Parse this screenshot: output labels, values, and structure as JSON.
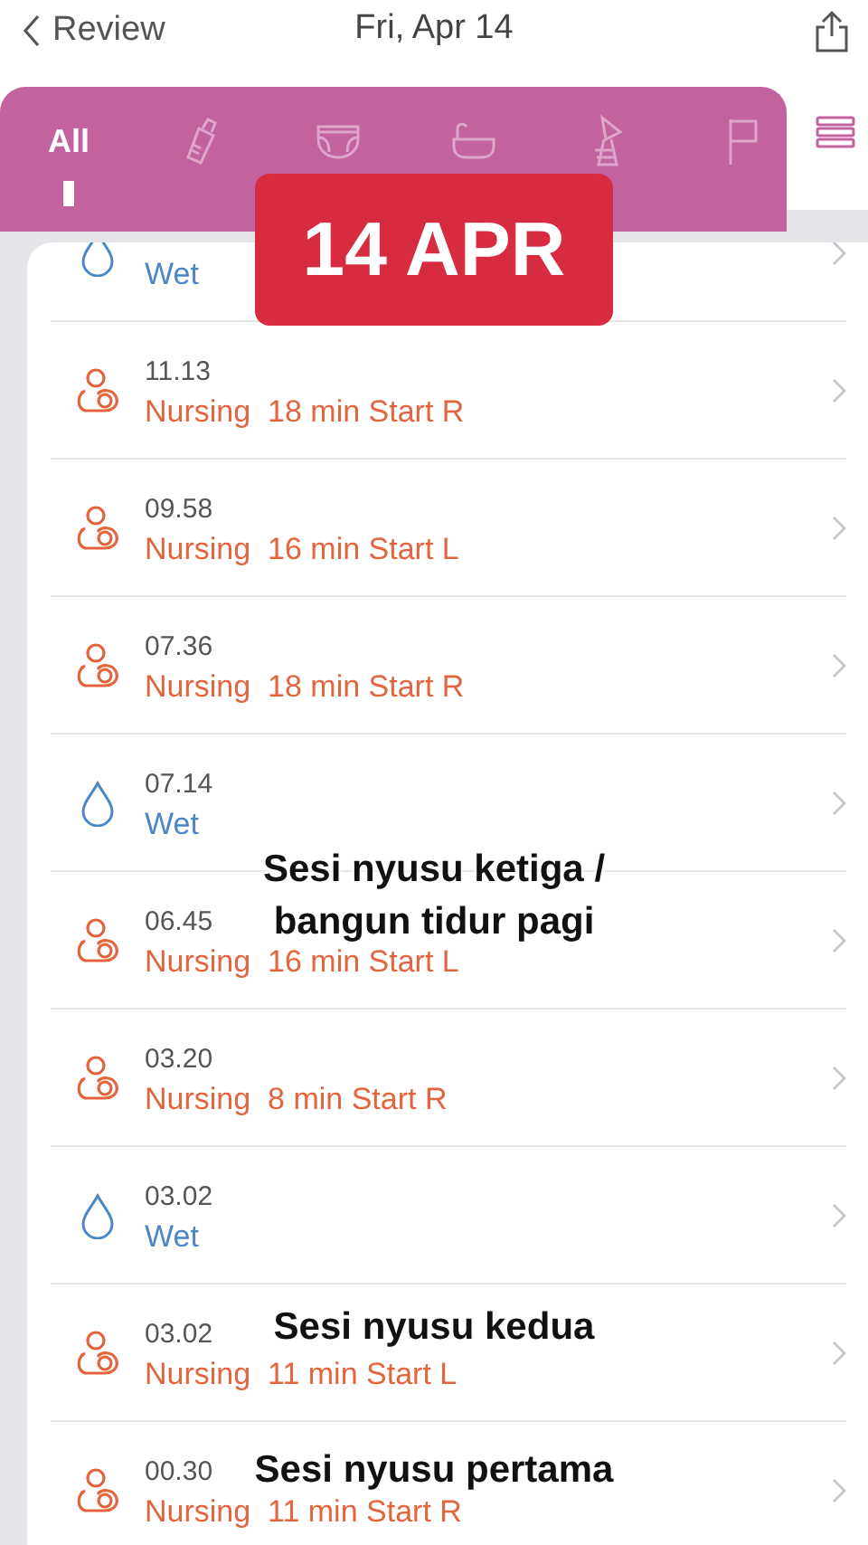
{
  "nav": {
    "back": "Review",
    "title": "Fri, Apr 14"
  },
  "tabs": [
    {
      "kind": "text",
      "label": "All",
      "selected": true
    },
    {
      "kind": "bottle",
      "selected": false
    },
    {
      "kind": "diaper",
      "selected": false
    },
    {
      "kind": "bath",
      "selected": false
    },
    {
      "kind": "pump",
      "selected": false
    },
    {
      "kind": "flag",
      "selected": false
    }
  ],
  "entries": [
    {
      "kind": "wet",
      "label": "Wet"
    },
    {
      "kind": "nursing",
      "time": "11.13",
      "label": "Nursing  18 min Start R"
    },
    {
      "kind": "nursing",
      "time": "09.58",
      "label": "Nursing  16 min Start L"
    },
    {
      "kind": "nursing",
      "time": "07.36",
      "label": "Nursing  18 min Start R"
    },
    {
      "kind": "wet",
      "time": "07.14",
      "label": "Wet"
    },
    {
      "kind": "nursing",
      "time": "06.45",
      "label": "Nursing  16 min Start L"
    },
    {
      "kind": "nursing",
      "time": "03.20",
      "label": "Nursing  8 min Start R"
    },
    {
      "kind": "wet",
      "time": "03.02",
      "label": "Wet"
    },
    {
      "kind": "nursing",
      "time": "03.02",
      "label": "Nursing  11 min Start L"
    },
    {
      "kind": "nursing",
      "time": "00.30",
      "label": "Nursing  11 min Start R"
    }
  ],
  "overlay": {
    "date_badge": "14 APR",
    "captions": [
      {
        "line1": "Sesi nyusu ketiga /",
        "line2": "bangun tidur pagi"
      },
      {
        "line1": "Sesi nyusu kedua"
      },
      {
        "line1": "Sesi nyusu pertama"
      }
    ]
  }
}
